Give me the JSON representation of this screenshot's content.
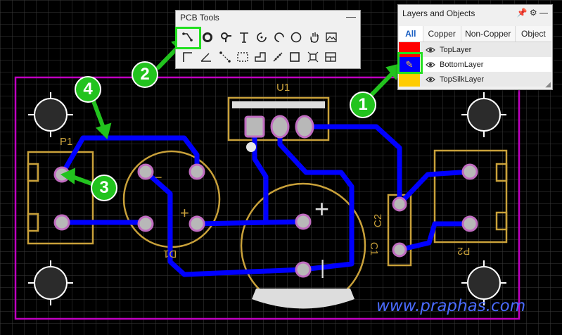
{
  "pcb_tools": {
    "title": "PCB Tools",
    "minimize": "—",
    "tools": [
      {
        "name": "track",
        "selected": true
      },
      {
        "name": "via"
      },
      {
        "name": "pad"
      },
      {
        "name": "text"
      },
      {
        "name": "arc"
      },
      {
        "name": "arc2"
      },
      {
        "name": "circle"
      },
      {
        "name": "pan"
      },
      {
        "name": "image"
      },
      {
        "name": "line"
      },
      {
        "name": "angle"
      },
      {
        "name": "connect"
      },
      {
        "name": "rect-dashed"
      },
      {
        "name": "solid-region"
      },
      {
        "name": "measure"
      },
      {
        "name": "rect"
      },
      {
        "name": "component"
      },
      {
        "name": "panel"
      }
    ]
  },
  "layers_panel": {
    "title": "Layers and Objects",
    "tabs": [
      "All",
      "Copper",
      "Non-Copper",
      "Object"
    ],
    "active_tab": "All",
    "rows": [
      {
        "label": "TopLayer",
        "color": "#ff0000"
      },
      {
        "label": "BottomLayer",
        "color": "#0000ff"
      },
      {
        "label": "TopSilkLayer",
        "color": "#ffcc00"
      }
    ]
  },
  "board": {
    "labels": {
      "p1": "P1",
      "u1": "U1",
      "d1": "D1",
      "c1": "C1",
      "c2": "C2",
      "p2": "P2",
      "minus": "−",
      "plus": "+",
      "cap_plus": "+",
      "cap_minus": "|"
    },
    "colors": {
      "outline": "#c000c0",
      "track": "#0000ff",
      "silk": "#c9a13a"
    }
  },
  "callouts": [
    "1",
    "2",
    "3",
    "4"
  ],
  "watermark": "www.praphas.com"
}
